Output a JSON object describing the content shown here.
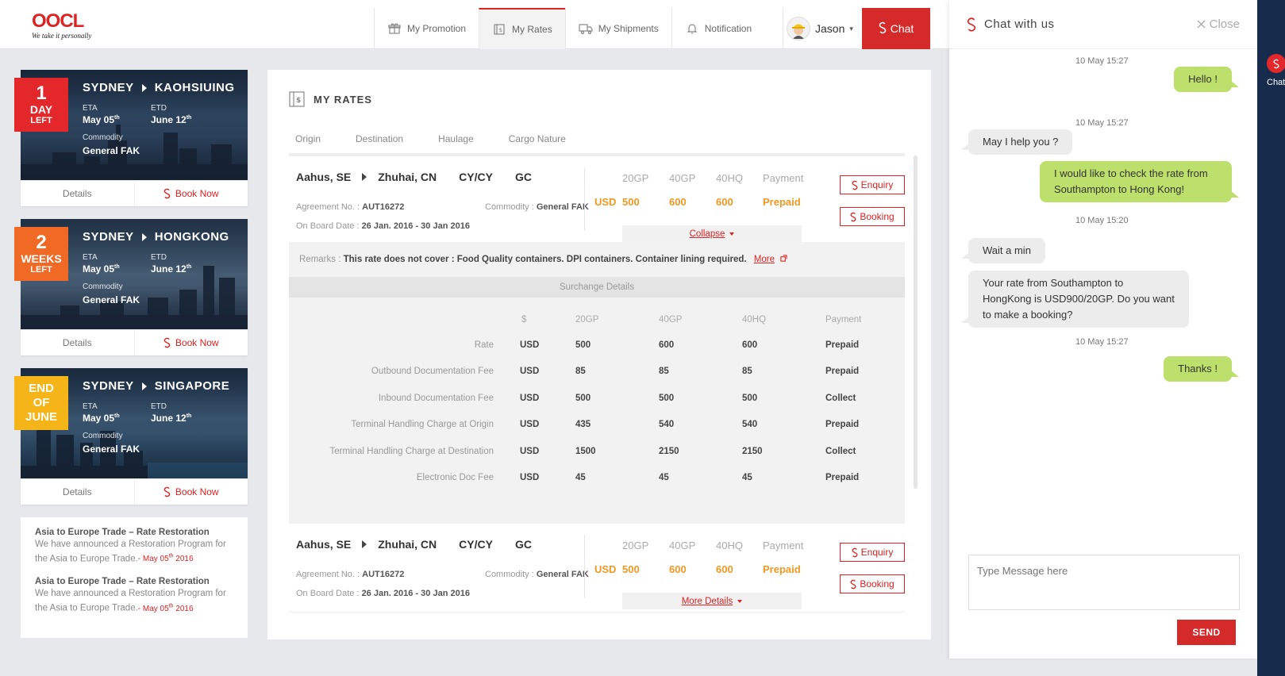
{
  "brand": {
    "logo_text": "OOCL",
    "tagline": "We take it personally"
  },
  "nav": {
    "items": [
      {
        "label": "My Promotion",
        "icon": "gift-icon"
      },
      {
        "label": "My Rates",
        "icon": "rates-icon"
      },
      {
        "label": "My Shipments",
        "icon": "truck-icon"
      },
      {
        "label": "Notification",
        "icon": "bell-icon"
      }
    ],
    "user_name": "Jason",
    "chat_label": "Chat"
  },
  "route_cards": [
    {
      "badge": [
        "1",
        "DAY",
        "LEFT"
      ],
      "badge_color": "#e3272b",
      "from": "SYDNEY",
      "to": "KAOHSIUING",
      "eta_label": "ETA",
      "eta": "May 05",
      "eta_sup": "th",
      "etd_label": "ETD",
      "etd": "June 12",
      "etd_sup": "th",
      "commodity_label": "Commodity",
      "commodity": "General FAK",
      "details": "Details",
      "book": "Book Now"
    },
    {
      "badge": [
        "2",
        "WEEKS",
        "LEFT"
      ],
      "badge_color": "#f06a25",
      "from": "SYDNEY",
      "to": "HONGKONG",
      "eta_label": "ETA",
      "eta": "May 05",
      "eta_sup": "th",
      "etd_label": "ETD",
      "etd": "June 12",
      "etd_sup": "th",
      "commodity_label": "Commodity",
      "commodity": "General FAK",
      "details": "Details",
      "book": "Book Now"
    },
    {
      "badge": [
        "END",
        "OF",
        "JUNE"
      ],
      "badge_color": "#f5b417",
      "from": "SYDNEY",
      "to": "SINGAPORE",
      "eta_label": "ETA",
      "eta": "May 05",
      "eta_sup": "th",
      "etd_label": "ETD",
      "etd": "June 12",
      "etd_sup": "th",
      "commodity_label": "Commodity",
      "commodity": "General FAK",
      "details": "Details",
      "book": "Book Now"
    }
  ],
  "news": [
    {
      "title": "Asia to Europe Trade – Rate Restoration",
      "text": "We have announced a Restoration Program for the Asia to Europe Trade.",
      "date": "- May 05",
      "date_sup": "th",
      "year": " 2016"
    },
    {
      "title": "Asia to Europe Trade – Rate Restoration",
      "text": "We have announced a Restoration Program for the Asia to Europe Trade.",
      "date": "- May 05",
      "date_sup": "th",
      "year": " 2016"
    }
  ],
  "rates": {
    "title": "MY RATES",
    "filters": [
      "Origin",
      "Destination",
      "Haulage",
      "Cargo Nature"
    ],
    "rows": [
      {
        "origin": "Aahus, SE",
        "destination": "Zhuhai, CN",
        "haulage": "CY/CY",
        "nature": "GC",
        "agreement_label": "Agreement No. :",
        "agreement": "AUT16272",
        "commodity_label": "Commodity :",
        "commodity": "General FAK",
        "onboard_label": "On Board Date :",
        "onboard": "26 Jan. 2016 - 30 Jan 2016",
        "price_heads": [
          "20GP",
          "40GP",
          "40HQ",
          "Payment"
        ],
        "currency": "USD",
        "prices": [
          "500",
          "600",
          "600"
        ],
        "payment": "Prepaid",
        "enquiry": "Enquiry",
        "booking": "Booking",
        "toggle": "Collapse"
      },
      {
        "origin": "Aahus, SE",
        "destination": "Zhuhai, CN",
        "haulage": "CY/CY",
        "nature": "GC",
        "agreement_label": "Agreement No. :",
        "agreement": "AUT16272",
        "commodity_label": "Commodity :",
        "commodity": "General FAK",
        "onboard_label": "On Board Date :",
        "onboard": "26 Jan. 2016 - 30 Jan 2016",
        "price_heads": [
          "20GP",
          "40GP",
          "40HQ",
          "Payment"
        ],
        "currency": "USD",
        "prices": [
          "500",
          "600",
          "600"
        ],
        "payment": "Prepaid",
        "enquiry": "Enquiry",
        "booking": "Booking",
        "toggle": "More Details"
      }
    ],
    "remarks_label": "Remarks :",
    "remarks": "This rate does not cover : Food Quality containers. DPI containers. Container lining required.",
    "more": "More",
    "surcharge_title": "Surchange Details",
    "surcharge_headers": [
      "$",
      "20GP",
      "40GP",
      "40HQ",
      "Payment"
    ],
    "surcharges": [
      {
        "name": "Rate",
        "cur": "USD",
        "v20": "500",
        "v40": "600",
        "vhq": "600",
        "pay": "Prepaid"
      },
      {
        "name": "Outbound Documentation Fee",
        "cur": "USD",
        "v20": "85",
        "v40": "85",
        "vhq": "85",
        "pay": "Prepaid"
      },
      {
        "name": "Inbound Documentation Fee",
        "cur": "USD",
        "v20": "500",
        "v40": "500",
        "vhq": "500",
        "pay": "Collect"
      },
      {
        "name": "Terminal Handling Charge at Origin",
        "cur": "USD",
        "v20": "435",
        "v40": "540",
        "vhq": "540",
        "pay": "Prepaid"
      },
      {
        "name": "Terminal Handling Charge at Destination",
        "cur": "USD",
        "v20": "1500",
        "v40": "2150",
        "vhq": "2150",
        "pay": "Collect"
      },
      {
        "name": "Electronic Doc Fee",
        "cur": "USD",
        "v20": "45",
        "v40": "45",
        "vhq": "45",
        "pay": "Prepaid"
      }
    ]
  },
  "chat": {
    "title": "Chat with us",
    "close": "Close",
    "messages": [
      {
        "time": "10 May 15:27",
        "dir": "out",
        "text": "Hello !"
      },
      {
        "time": "10 May 15:27",
        "dir": "in",
        "text": "May I help you ?"
      },
      {
        "time": "",
        "dir": "out",
        "text": "I would like to check the rate from Southampton to Hong Kong!"
      },
      {
        "time": "10 May 15:20",
        "dir": "in",
        "text": "Wait a min"
      },
      {
        "time": "",
        "dir": "in",
        "text": "Your rate from Southampton to HongKong is USD900/20GP. Do you want to make a booking?"
      },
      {
        "time": "10 May 15:27",
        "dir": "out",
        "text": "Thanks !"
      }
    ],
    "input_placeholder": "Type Message here",
    "send": "SEND"
  },
  "rail": {
    "label": "Chat"
  }
}
